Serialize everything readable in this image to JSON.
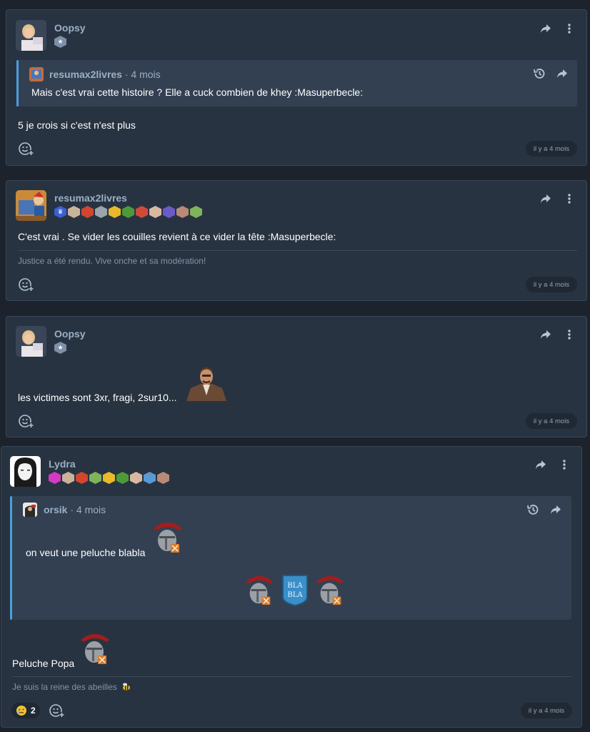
{
  "posts": [
    {
      "author": "Oopsy",
      "quote": {
        "author": "resumax2livres",
        "time": "· 4 mois",
        "text": "Mais c'est vrai cette histoire ? Elle a cuck combien de khey :Masuperbecle:"
      },
      "body": "5 je crois si c'est n'est plus",
      "time": "il y a 4 mois"
    },
    {
      "author": "resumax2livres",
      "body": "C'est vrai . Se vider les couilles revient à ce vider la tête :Masuperbecle:",
      "signature": "Justice a été rendu. Vive onche et sa modération!",
      "time": "il y a 4 mois"
    },
    {
      "author": "Oopsy",
      "body": "les victimes sont 3xr, fragi, 2sur10...",
      "time": "il y a 4 mois"
    },
    {
      "author": "Lydra",
      "quote": {
        "author": "orsik",
        "time": "· 4 mois",
        "text": "on veut une peluche blabla"
      },
      "body": "Peluche Popa",
      "signature": "Je suis la reine des abeilles",
      "reaction_count": "2",
      "time": "il y a 4 mois"
    }
  ],
  "icons": {
    "share": "share-arrow-icon",
    "menu": "vertical-dots-icon",
    "history": "history-icon",
    "react": "add-reaction-icon"
  },
  "colors": {
    "page_bg": "#1c232d",
    "card_bg": "#283341",
    "quote_bg": "#334052",
    "quote_bar": "#4a9fdc",
    "author": "#9bb0c6"
  }
}
